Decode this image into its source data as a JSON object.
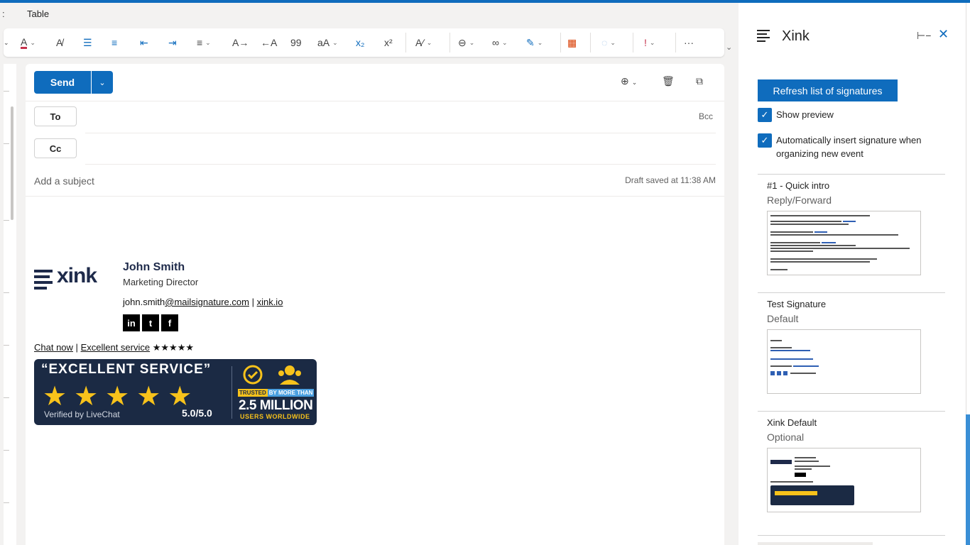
{
  "menu": {
    "colon": ":",
    "active_tab": "Table"
  },
  "ribbon": {
    "tools": [
      {
        "name": "font-color-icon",
        "glyph": "A"
      },
      {
        "name": "clear-format-icon",
        "glyph": "A̸"
      },
      {
        "name": "bullets-icon",
        "glyph": "☰"
      },
      {
        "name": "numbering-icon",
        "glyph": "≡"
      },
      {
        "name": "decrease-indent-icon",
        "glyph": "⇤"
      },
      {
        "name": "increase-indent-icon",
        "glyph": "⇥"
      },
      {
        "name": "align-icon",
        "glyph": "≡"
      },
      {
        "name": "ltr-icon",
        "glyph": "A→"
      },
      {
        "name": "rtl-icon",
        "glyph": "←A"
      },
      {
        "name": "quote-icon",
        "glyph": "99"
      },
      {
        "name": "change-case-icon",
        "glyph": "aA"
      },
      {
        "name": "subscript-icon",
        "glyph": "x₂"
      },
      {
        "name": "superscript-icon",
        "glyph": "x²"
      },
      {
        "name": "styles-icon",
        "glyph": "A∕"
      },
      {
        "name": "attach-icon",
        "glyph": "⊖"
      },
      {
        "name": "link-icon",
        "glyph": "∞"
      },
      {
        "name": "signature-icon",
        "glyph": "✎"
      },
      {
        "name": "apps-icon",
        "glyph": "▦"
      },
      {
        "name": "editor-icon",
        "glyph": "◌"
      },
      {
        "name": "importance-icon",
        "glyph": "!"
      },
      {
        "name": "more-icon",
        "glyph": "···"
      }
    ]
  },
  "compose": {
    "send_label": "Send",
    "to_label": "To",
    "cc_label": "Cc",
    "bcc_label": "Bcc",
    "subject_placeholder": "Add a subject",
    "draft_status": "Draft saved at 11:38 AM"
  },
  "signature": {
    "logo_text": "xink",
    "name": "John Smith",
    "role": "Marketing Director",
    "email_user": "john.smith",
    "email_domain": "@mailsignature.com",
    "separator": "|",
    "website": "xink.io",
    "socials": [
      "in",
      "t",
      "f"
    ],
    "chat_link": "Chat now",
    "service_link": "Excellent service",
    "stars": "★★★★★",
    "badge": {
      "quote": "“EXCELLENT SERVICE”",
      "stars": "★★★★★",
      "verified": "Verified by LiveChat",
      "score": "5.0/5.0",
      "trusted": "TRUSTED",
      "by_more_than": "BY MORE THAN",
      "million": "2.5 MILLION",
      "users": "USERS WORLDWIDE"
    }
  },
  "pane": {
    "title": "Xink",
    "refresh_label": "Refresh list of signatures",
    "show_preview": {
      "label": "Show preview",
      "checked": true
    },
    "auto_insert": {
      "label": "Automatically insert signature when organizing new event",
      "checked": true
    },
    "signatures": [
      {
        "name": "#1 - Quick intro",
        "type": "Reply/Forward"
      },
      {
        "name": "Test Signature",
        "type": "Default"
      },
      {
        "name": "Xink Default",
        "type": "Optional"
      }
    ]
  },
  "colors": {
    "accent": "#0f6cbd",
    "brand_navy": "#1b2a44",
    "star": "#f7c21b"
  }
}
